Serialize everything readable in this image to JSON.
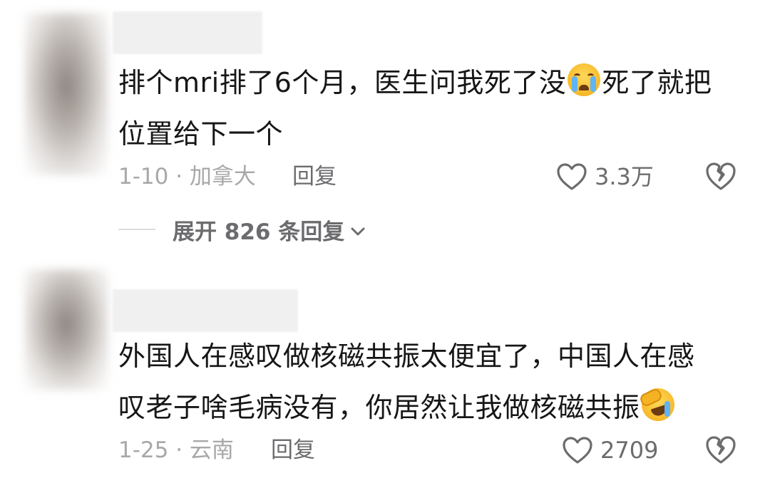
{
  "comments": [
    {
      "text_line1": "排个mri排了6个月，医生问我死了没",
      "text_line1_tail": "死了就把",
      "text_line2": "位置给下一个",
      "emoji": "loudly-crying-face",
      "date_location": "1-10 · 加拿大",
      "reply_label": "回复",
      "likes": "3.3万"
    },
    {
      "text_line1": "外国人在感叹做核磁共振太便宜了，中国人在感",
      "text_line2": "叹老子啥毛病没有，你居然让我做核磁共振",
      "emoji": "rolling-laughing-face",
      "date_location": "1-25 · 云南",
      "reply_label": "回复",
      "likes": "2709"
    }
  ],
  "expand_replies": "展开 826 条回复",
  "colors": {
    "text": "#161616",
    "meta": "#a8a8aa",
    "action": "#6c6c6f",
    "background": "#ffffff"
  }
}
